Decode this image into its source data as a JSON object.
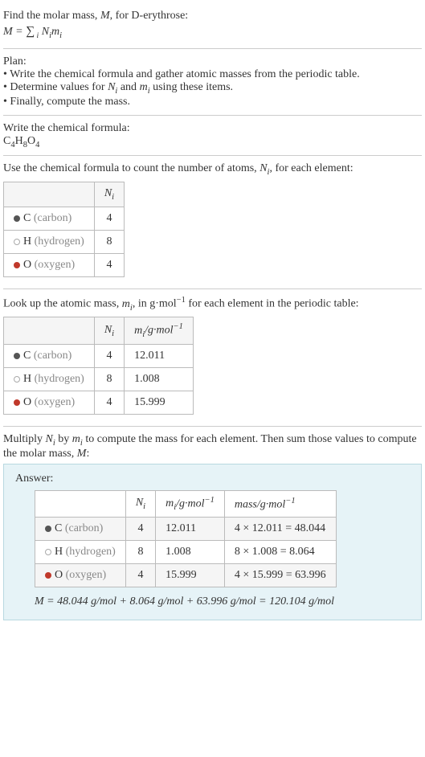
{
  "intro": {
    "line1": "Find the molar mass, M, for D-erythrose:",
    "formula_html": "M = ∑ Nᵢmᵢ",
    "formula_under": "i"
  },
  "plan": {
    "title": "Plan:",
    "items": [
      "• Write the chemical formula and gather atomic masses from the periodic table.",
      "• Determine values for Nᵢ and mᵢ using these items.",
      "• Finally, compute the mass."
    ]
  },
  "chem_formula": {
    "title": "Write the chemical formula:",
    "formula": "C₄H₈O₄"
  },
  "count_section": {
    "title": "Use the chemical formula to count the number of atoms, Nᵢ, for each element:",
    "header_ni": "Nᵢ",
    "rows": [
      {
        "dot": "dot-c",
        "sym": "C",
        "name": "(carbon)",
        "ni": "4"
      },
      {
        "dot": "dot-h",
        "sym": "H",
        "name": "(hydrogen)",
        "ni": "8"
      },
      {
        "dot": "dot-o",
        "sym": "O",
        "name": "(oxygen)",
        "ni": "4"
      }
    ]
  },
  "mass_section": {
    "title": "Look up the atomic mass, mᵢ, in g·mol⁻¹ for each element in the periodic table:",
    "header_ni": "Nᵢ",
    "header_mi": "mᵢ/g·mol⁻¹",
    "rows": [
      {
        "dot": "dot-c",
        "sym": "C",
        "name": "(carbon)",
        "ni": "4",
        "mi": "12.011"
      },
      {
        "dot": "dot-h",
        "sym": "H",
        "name": "(hydrogen)",
        "ni": "8",
        "mi": "1.008"
      },
      {
        "dot": "dot-o",
        "sym": "O",
        "name": "(oxygen)",
        "ni": "4",
        "mi": "15.999"
      }
    ]
  },
  "multiply_section": {
    "title": "Multiply Nᵢ by mᵢ to compute the mass for each element. Then sum those values to compute the molar mass, M:"
  },
  "answer": {
    "label": "Answer:",
    "header_ni": "Nᵢ",
    "header_mi": "mᵢ/g·mol⁻¹",
    "header_mass": "mass/g·mol⁻¹",
    "rows": [
      {
        "dot": "dot-c",
        "sym": "C",
        "name": "(carbon)",
        "ni": "4",
        "mi": "12.011",
        "mass": "4 × 12.011 = 48.044"
      },
      {
        "dot": "dot-h",
        "sym": "H",
        "name": "(hydrogen)",
        "ni": "8",
        "mi": "1.008",
        "mass": "8 × 1.008 = 8.064"
      },
      {
        "dot": "dot-o",
        "sym": "O",
        "name": "(oxygen)",
        "ni": "4",
        "mi": "15.999",
        "mass": "4 × 15.999 = 63.996"
      }
    ],
    "final": "M = 48.044 g/mol + 8.064 g/mol + 63.996 g/mol = 120.104 g/mol"
  }
}
